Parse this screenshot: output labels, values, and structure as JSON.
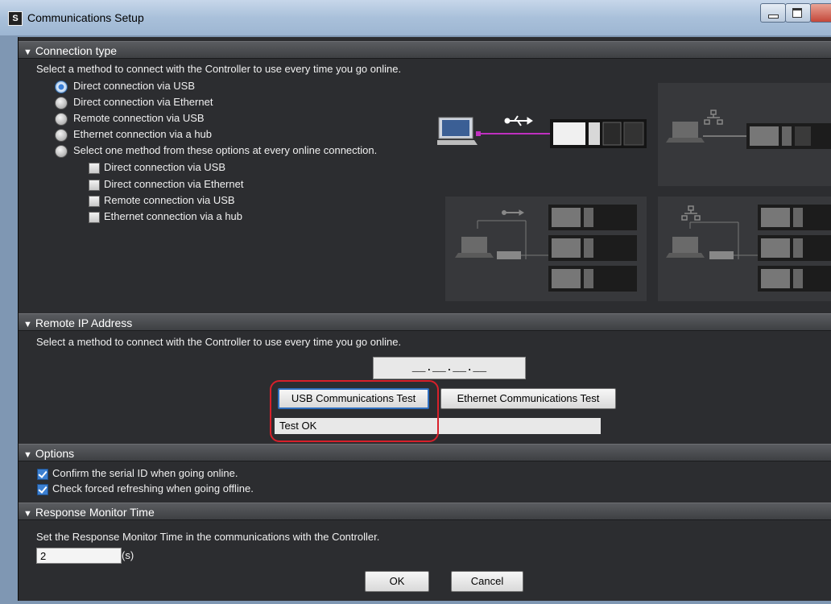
{
  "window": {
    "title": "Communications Setup"
  },
  "sections": {
    "connection_type": {
      "header": "Connection type",
      "description": "Select a method to connect with the Controller to use every time you go online.",
      "options": [
        {
          "label": "Direct connection via USB",
          "selected": true
        },
        {
          "label": "Direct connection via Ethernet",
          "selected": false
        },
        {
          "label": "Remote connection via USB",
          "selected": false
        },
        {
          "label": "Ethernet connection via a hub",
          "selected": false
        },
        {
          "label": "Select one method from these options at every online connection.",
          "selected": false
        }
      ],
      "sub_options": [
        {
          "label": "Direct connection via USB",
          "checked": false
        },
        {
          "label": "Direct connection via Ethernet",
          "checked": false
        },
        {
          "label": "Remote connection via USB",
          "checked": false
        },
        {
          "label": "Ethernet connection via a hub",
          "checked": false
        }
      ]
    },
    "remote_ip": {
      "header": "Remote IP Address",
      "description": "Select a method to connect with the Controller to use every time you go online.",
      "ip_value": "__.__.__.__",
      "usb_test_label": "USB Communications Test",
      "ethernet_test_label": "Ethernet Communications Test",
      "result_text": "Test OK"
    },
    "options": {
      "header": "Options",
      "items": [
        {
          "label": "Confirm the serial ID when going online.",
          "checked": true
        },
        {
          "label": "Check forced refreshing when going offline.",
          "checked": true
        }
      ]
    },
    "response_monitor": {
      "header": "Response Monitor Time",
      "description": "Set the Response Monitor Time in the communications with the Controller.",
      "value": "2",
      "unit": "(s)"
    }
  },
  "buttons": {
    "ok": "OK",
    "cancel": "Cancel"
  },
  "colors": {
    "accent_link": "#c030c0",
    "highlight": "#d8202a"
  }
}
